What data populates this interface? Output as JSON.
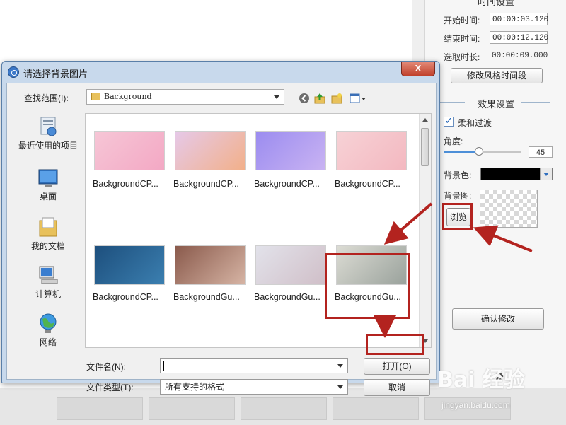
{
  "right_panel": {
    "time_section_title": "时间设置",
    "start_time_label": "开始时间:",
    "start_time_value": "00:00:03.120",
    "end_time_label": "结束时间:",
    "end_time_value": "00:00:12.120",
    "duration_label": "选取时长:",
    "duration_value": "00:00:09.000",
    "modify_segment_button": "修改风格时间段",
    "effect_section_title": "效果设置",
    "soft_transition_label": "柔和过渡",
    "soft_transition_checked": true,
    "angle_label": "角度:",
    "angle_value": "45",
    "angle_fraction": 0.45,
    "bg_color_label": "背景色:",
    "bg_color_value": "#000000",
    "bg_image_label": "背景图:",
    "browse_button": "浏览",
    "confirm_button": "确认修改"
  },
  "dialog": {
    "title": "请选择背景图片",
    "close_label": "X",
    "look_in_label": "查找范围(I):",
    "look_in_value": "Background",
    "places": [
      {
        "label": "最近使用的项目",
        "icon": "recent-items-icon"
      },
      {
        "label": "桌面",
        "icon": "desktop-icon"
      },
      {
        "label": "我的文档",
        "icon": "my-documents-icon"
      },
      {
        "label": "计算机",
        "icon": "computer-icon"
      },
      {
        "label": "网络",
        "icon": "network-icon"
      }
    ],
    "files": [
      {
        "name": "BackgroundCP...",
        "color1": "#f6c6d6",
        "color2": "#f3a8c4"
      },
      {
        "name": "BackgroundCP...",
        "color1": "#e6c9e8",
        "color2": "#f2b08a"
      },
      {
        "name": "BackgroundCP...",
        "color1": "#9b8cf0",
        "color2": "#c9b3f2"
      },
      {
        "name": "BackgroundCP...",
        "color1": "#f7d2d6",
        "color2": "#f3b8c0"
      },
      {
        "name": "BackgroundCP...",
        "color1": "#1d4f7d",
        "color2": "#3b7fb0"
      },
      {
        "name": "BackgroundGu...",
        "color1": "#8a5a4c",
        "color2": "#d6b4a4"
      },
      {
        "name": "BackgroundGu...",
        "color1": "#e2e2ea",
        "color2": "#d0bfc8"
      },
      {
        "name": "BackgroundGu...",
        "color1": "#dcdcd4",
        "color2": "#9aa29c"
      }
    ],
    "filename_label": "文件名(N):",
    "filename_value": "",
    "filetype_label": "文件类型(T):",
    "filetype_value": "所有支持的格式",
    "open_button": "打开(O)",
    "cancel_button": "取消"
  },
  "watermark": {
    "text": "Bai 经验",
    "sub": "jingyan.baidu.com"
  },
  "colors": {
    "annotation_red": "#b3231f",
    "dialog_frame": "#c8d9ec"
  }
}
